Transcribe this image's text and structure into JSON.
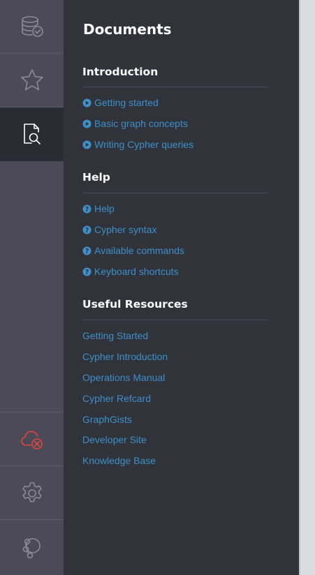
{
  "drawer": {
    "title": "Documents",
    "sections": [
      {
        "heading": "Introduction",
        "items": [
          {
            "label": "Getting started",
            "icon": "play-circle-icon"
          },
          {
            "label": "Basic graph concepts",
            "icon": "play-circle-icon"
          },
          {
            "label": "Writing Cypher queries",
            "icon": "play-circle-icon"
          }
        ]
      },
      {
        "heading": "Help",
        "items": [
          {
            "label": "Help",
            "icon": "question-circle-icon"
          },
          {
            "label": "Cypher syntax",
            "icon": "question-circle-icon"
          },
          {
            "label": "Available commands",
            "icon": "question-circle-icon"
          },
          {
            "label": "Keyboard shortcuts",
            "icon": "question-circle-icon"
          }
        ]
      },
      {
        "heading": "Useful Resources",
        "items": [
          {
            "label": "Getting Started"
          },
          {
            "label": "Cypher Introduction"
          },
          {
            "label": "Operations Manual"
          },
          {
            "label": "Cypher Refcard"
          },
          {
            "label": "GraphGists"
          },
          {
            "label": "Developer Site"
          },
          {
            "label": "Knowledge Base"
          }
        ]
      }
    ]
  },
  "rail": {
    "top_items": [
      {
        "icon": "database-check-icon",
        "active": false
      },
      {
        "icon": "star-icon",
        "active": false
      },
      {
        "icon": "document-search-icon",
        "active": true
      }
    ],
    "bottom_items": [
      {
        "icon": "cloud-disconnected-icon",
        "status": "error"
      },
      {
        "icon": "gear-icon"
      },
      {
        "icon": "neo4j-logo-icon"
      }
    ]
  },
  "colors": {
    "rail_bg": "#4d4a57",
    "rail_active_bg": "#2a2c33",
    "drawer_bg": "#30333a",
    "link": "#3f8fc9",
    "error": "#e0463e",
    "icon": "#8d8a96"
  }
}
